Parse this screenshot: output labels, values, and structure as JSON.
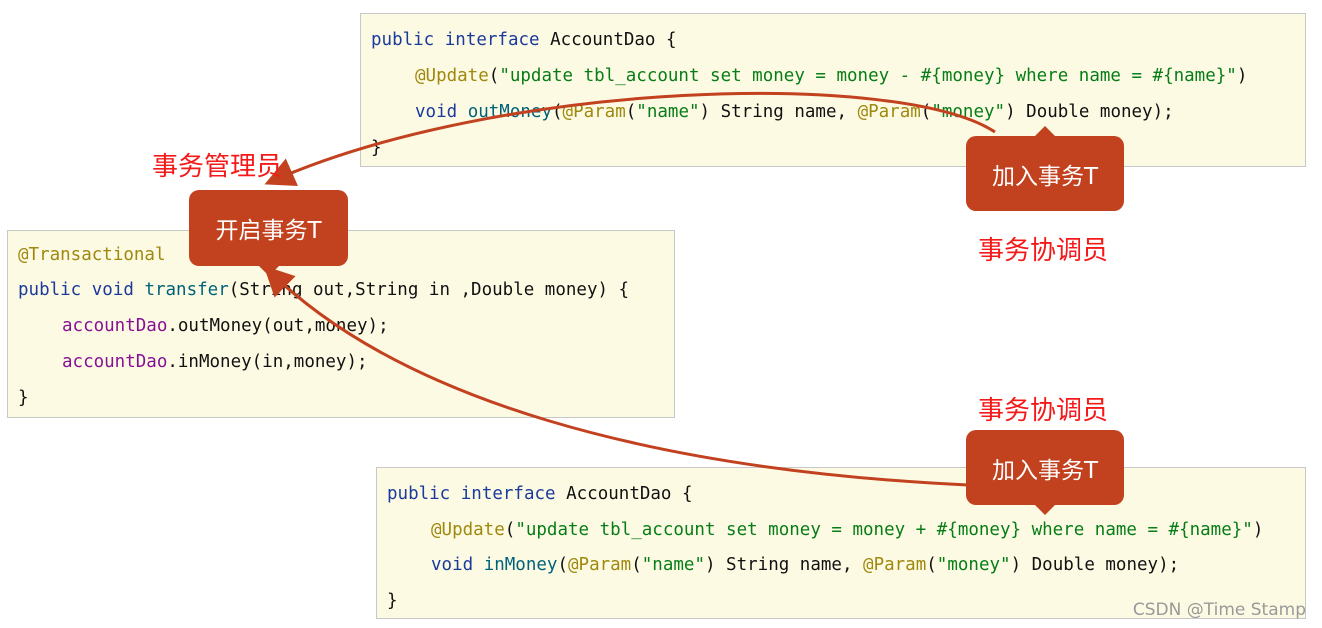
{
  "top_code": {
    "l1": [
      "public",
      " interface",
      " AccountDao {"
    ],
    "l2": [
      "@Update",
      "(",
      "\"update tbl_account set money = money - #{money} where name = #{name}\"",
      ")"
    ],
    "l3": [
      "void",
      " outMoney",
      "(",
      "@Param",
      "(",
      "\"name\"",
      ") String name, ",
      "@Param",
      "(",
      "\"money\"",
      ") Double money);"
    ],
    "l4": "}"
  },
  "mid_code": {
    "l1": "@Transactional",
    "l2": [
      "public",
      " void",
      " transfer",
      "(String out,String in ,Double money) {"
    ],
    "l3": [
      "accountDao",
      ".outMoney(out,money);"
    ],
    "l4": [
      "accountDao",
      ".inMoney(in,money);"
    ],
    "l5": "}"
  },
  "bot_code": {
    "l1": [
      "public",
      " interface",
      " AccountDao {"
    ],
    "l2": [
      "@Update",
      "(",
      "\"update tbl_account set money = money + #{money} where name = #{name}\"",
      ")"
    ],
    "l3": [
      "void",
      " inMoney",
      "(",
      "@Param",
      "(",
      "\"name\"",
      ") String name, ",
      "@Param",
      "(",
      "\"money\"",
      ") Double money);"
    ],
    "l4": "}"
  },
  "labels": {
    "manager": "事务管理员",
    "coordinator_top": "事务协调员",
    "coordinator_bottom": "事务协调员"
  },
  "callouts": {
    "start": "开启事务T",
    "join_top": "加入事务T",
    "join_bottom": "加入事务T"
  },
  "watermark": "CSDN @Time Stamp",
  "colors": {
    "callout": "#c2411f",
    "role": "#f51a1a",
    "arrow": "#c2411f"
  }
}
